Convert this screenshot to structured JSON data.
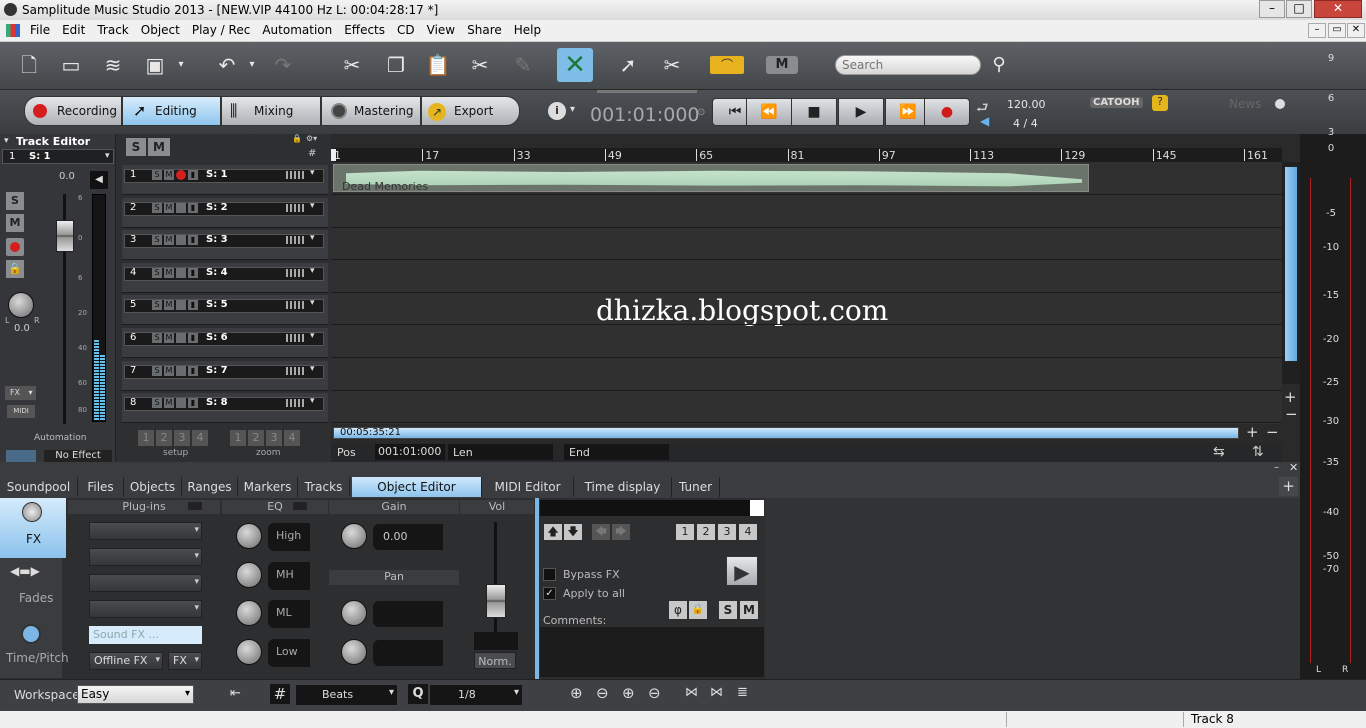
{
  "window": {
    "title": "Samplitude Music Studio 2013 - [NEW.VIP   44100 Hz L: 00:04:28:17 *]",
    "controls": [
      "–",
      "□",
      "✕"
    ],
    "mdi_controls": [
      "–",
      "▭",
      "✕"
    ]
  },
  "menu": [
    "File",
    "Edit",
    "Track",
    "Object",
    "Play / Rec",
    "Automation",
    "Effects",
    "CD",
    "View",
    "Share",
    "Help"
  ],
  "toolbar": {
    "search_placeholder": "Search",
    "m_label": "M"
  },
  "modes": [
    {
      "label": "Recording"
    },
    {
      "label": "Editing"
    },
    {
      "label": "Mixing"
    },
    {
      "label": "Mastering"
    },
    {
      "label": "Export"
    }
  ],
  "transport": {
    "position": "001:01:000",
    "tempo": "120.00",
    "signature": "4 / 4",
    "buttons": [
      "⏮",
      "⏪",
      "■",
      "▶",
      "⏩",
      "●"
    ]
  },
  "brand": {
    "catooh": "CATOOH",
    "news": "News"
  },
  "track_editor": {
    "title": "Track Editor",
    "selector_num": "1",
    "selector_name": "S: 1",
    "volume_value": "0.0",
    "pan_value": "0.0",
    "pan_l": "L",
    "pan_r": "R",
    "fx_label": "FX",
    "midi_label": "MIDI",
    "automation_label": "Automation",
    "no_effect": "No Effect",
    "meter_scale": [
      "6",
      "0",
      "6",
      "20",
      "40",
      "60",
      "80"
    ]
  },
  "track_header_controls": {
    "s": "S",
    "m": "M"
  },
  "tracks": [
    {
      "num": "1",
      "name": "S: 1"
    },
    {
      "num": "2",
      "name": "S: 2"
    },
    {
      "num": "3",
      "name": "S: 3"
    },
    {
      "num": "4",
      "name": "S: 4"
    },
    {
      "num": "5",
      "name": "S: 5"
    },
    {
      "num": "6",
      "name": "S: 6"
    },
    {
      "num": "7",
      "name": "S: 7"
    },
    {
      "num": "8",
      "name": "S: 8"
    }
  ],
  "track_footer": {
    "setup_label": "setup",
    "zoom_label": "zoom",
    "setup_nums": [
      "1",
      "2",
      "3",
      "4"
    ],
    "zoom_nums": [
      "1",
      "2",
      "3",
      "4"
    ]
  },
  "ruler": [
    "1",
    "17",
    "33",
    "49",
    "65",
    "81",
    "97",
    "113",
    "129",
    "145",
    "161"
  ],
  "clip": {
    "name": "Dead Memories"
  },
  "watermark": "dhizka.blogspot.com",
  "scroll": {
    "time": "00:05:35:21"
  },
  "posbar": {
    "pos_label": "Pos",
    "pos_value": "001:01:000",
    "len_label": "Len",
    "end_label": "End"
  },
  "meter_scale": [
    "9",
    "6",
    "3",
    "0",
    "-5",
    "-10",
    "-15",
    "-20",
    "-25",
    "-30",
    "-35",
    "-40",
    "-50",
    "-70"
  ],
  "meter_lr": [
    "L",
    "R"
  ],
  "bottom_tabs": [
    "Soundpool",
    "Files",
    "Objects",
    "Ranges",
    "Markers",
    "Tracks",
    "Object Editor",
    "MIDI Editor",
    "Time display",
    "Tuner"
  ],
  "object_editor": {
    "side_tabs": [
      "FX",
      "Fades",
      "Time/Pitch"
    ],
    "plugins_header": "Plug-ins",
    "eq_header": "EQ",
    "gain_header": "Gain",
    "vol_header": "Vol",
    "pan_header": "Pan",
    "eq_bands": [
      "High",
      "MH",
      "ML",
      "Low"
    ],
    "gain_value": "0.00",
    "soundfx_placeholder": "Sound FX ...",
    "offline_fx": "Offline FX",
    "fx_small": "FX",
    "norm": "Norm.",
    "numbers": [
      "1",
      "2",
      "3",
      "4"
    ],
    "bypass_fx": "Bypass FX",
    "apply_all": "Apply to all",
    "comments": "Comments:",
    "s_label": "S",
    "m_label": "M"
  },
  "statusbar": {
    "workspace_label": "Workspace:",
    "workspace_value": "Easy",
    "beats_value": "Beats",
    "quant_value": "1/8"
  },
  "win_status": "Track 8"
}
